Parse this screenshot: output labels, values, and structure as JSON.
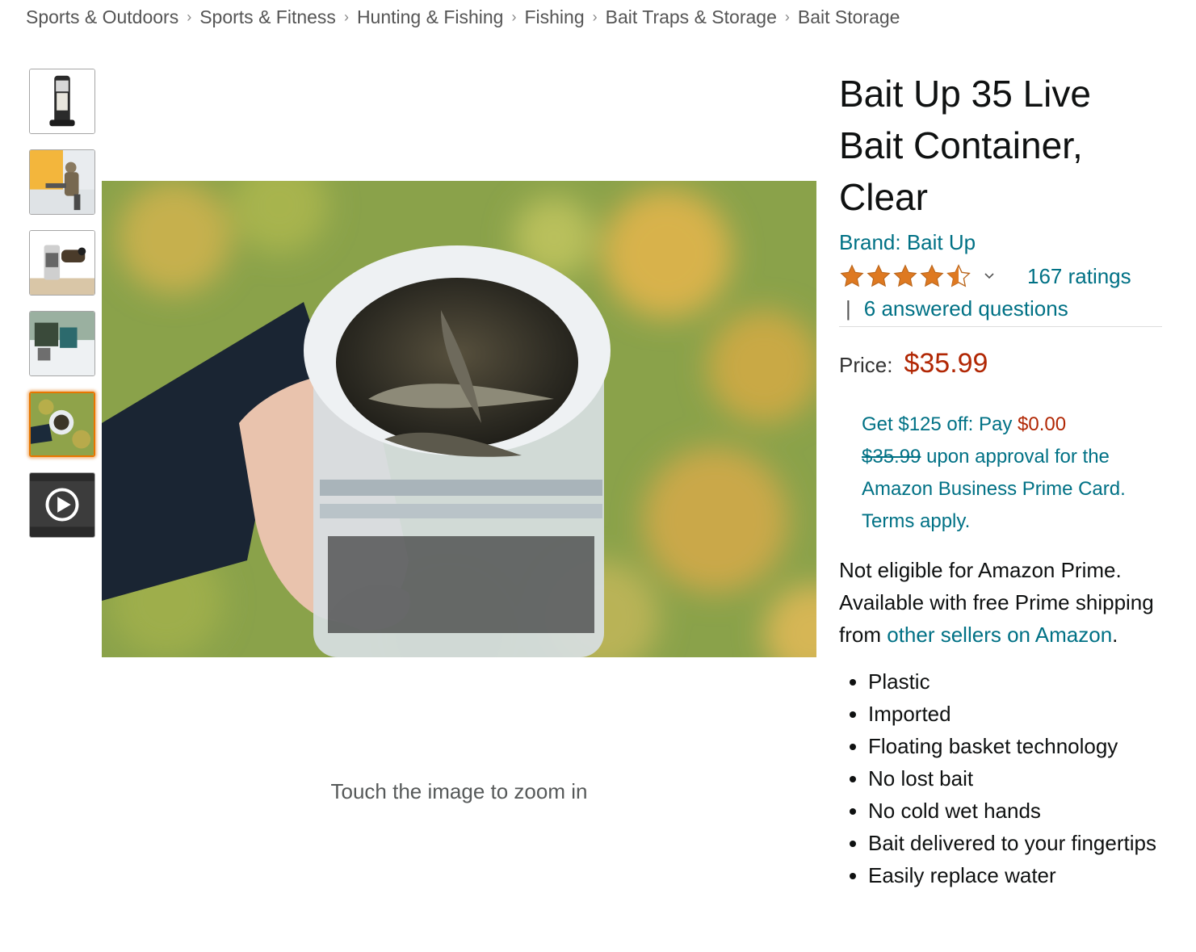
{
  "breadcrumb": [
    "Sports & Outdoors",
    "Sports & Fitness",
    "Hunting & Fishing",
    "Fishing",
    "Bait Traps & Storage",
    "Bait Storage"
  ],
  "breadcrumb_separator": "›",
  "zoom_hint": "Touch the image to zoom in",
  "product": {
    "title": "Bait Up 35 Live Bait Container, Clear",
    "brand": "Brand: Bait Up",
    "rating_value": 4.5,
    "ratings_count": "167 ratings",
    "qa_separator": "|",
    "answered_questions": "6 answered questions",
    "price_label": "Price:",
    "price": "$35.99"
  },
  "promo": {
    "line1_prefix": "Get $125 off: Pay ",
    "pay_amount": "$0.00",
    "struck_price": "$35.99",
    "rest": " upon approval for the Amazon Business Prime Card. Terms apply."
  },
  "prime_notice": {
    "text": "Not eligible for Amazon Prime. Available with free Prime shipping from ",
    "link": "other sellers on Amazon",
    "end": "."
  },
  "features": [
    "Plastic",
    "Imported",
    "Floating basket technology",
    "No lost bait",
    "No cold wet hands",
    "Bait delivered to your fingertips",
    "Easily replace water"
  ],
  "colors": {
    "link": "#007185",
    "price": "#b12704",
    "star": "#de7921",
    "selected_thumb": "#e77600"
  },
  "thumbnails": [
    {
      "icon": "product-thumb-icon"
    },
    {
      "icon": "angler-thumb-icon"
    },
    {
      "icon": "container-thumb-icon"
    },
    {
      "icon": "ice-fishing-thumb-icon"
    },
    {
      "icon": "hand-held-thumb-icon",
      "selected": true
    },
    {
      "icon": "video-play-icon"
    }
  ]
}
